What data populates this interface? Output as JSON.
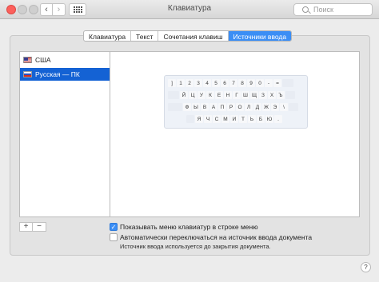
{
  "window": {
    "title": "Клавиатура"
  },
  "toolbar": {
    "back_glyph": "‹",
    "forward_glyph": "›",
    "show_all_icon": "grid-icon"
  },
  "search": {
    "placeholder": "Поиск"
  },
  "tabs": [
    {
      "label": "Клавиатура",
      "active": false
    },
    {
      "label": "Текст",
      "active": false
    },
    {
      "label": "Сочетания клавиш",
      "active": false
    },
    {
      "label": "Источники ввода",
      "active": true
    }
  ],
  "sources": [
    {
      "label": "США",
      "flag": "us",
      "selected": false
    },
    {
      "label": "Русская — ПК",
      "flag": "ru",
      "selected": true
    }
  ],
  "keyboard": {
    "rows": [
      [
        "]",
        "1",
        "2",
        "3",
        "4",
        "5",
        "6",
        "7",
        "8",
        "9",
        "0",
        "-",
        "=",
        ""
      ],
      [
        "",
        "Й",
        "Ц",
        "У",
        "К",
        "Е",
        "Н",
        "Г",
        "Ш",
        "Щ",
        "З",
        "Х",
        "Ъ",
        ""
      ],
      [
        "",
        "Ф",
        "Ы",
        "В",
        "А",
        "П",
        "Р",
        "О",
        "Л",
        "Д",
        "Ж",
        "Э",
        "\\",
        ""
      ],
      [
        "",
        "Я",
        "Ч",
        "С",
        "М",
        "И",
        "Т",
        "Ь",
        "Б",
        "Ю",
        "."
      ]
    ]
  },
  "buttons": {
    "add": "+",
    "remove": "−",
    "help": "?"
  },
  "options": {
    "show_menu": {
      "label": "Показывать меню клавиатур в строке меню",
      "checked": true
    },
    "auto_switch": {
      "label": "Автоматически переключаться на источник ввода документа",
      "checked": false
    },
    "note": "Источник ввода используется до закрытия документа."
  },
  "colors": {
    "accent": "#3b8ef5",
    "selection": "#1462d4",
    "close": "#fc605c"
  }
}
